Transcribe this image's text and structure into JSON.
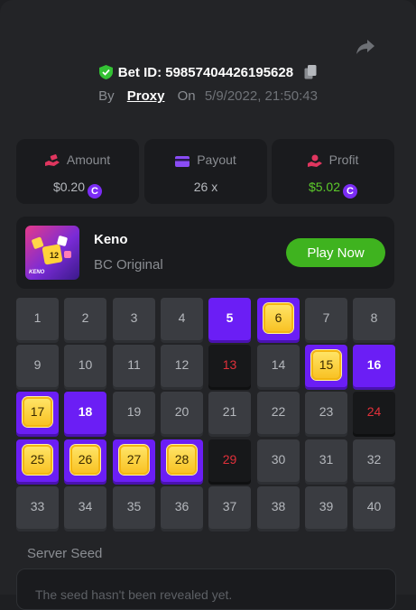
{
  "bet": {
    "label": "Bet ID:",
    "id": "59857404426195628"
  },
  "byline": {
    "by": "By",
    "user": "Proxy",
    "on": "On",
    "date": "5/9/2022, 21:50:43"
  },
  "stats": [
    {
      "label": "Amount",
      "value": "$0.20",
      "icon": "money-hand-icon",
      "coin": true
    },
    {
      "label": "Payout",
      "value": "26 x",
      "icon": "card-icon",
      "coin": false
    },
    {
      "label": "Profit",
      "value": "$5.02",
      "icon": "coin-hand-icon",
      "coin": true,
      "color": "#5dcb2b"
    }
  ],
  "game": {
    "name": "Keno",
    "subtitle": "BC Original",
    "play": "Play Now",
    "thumb_label": "KENO",
    "thumb_number": "12"
  },
  "grid": [
    {
      "n": "1",
      "s": "none"
    },
    {
      "n": "2",
      "s": "none"
    },
    {
      "n": "3",
      "s": "none"
    },
    {
      "n": "4",
      "s": "none"
    },
    {
      "n": "5",
      "s": "selected"
    },
    {
      "n": "6",
      "s": "hit"
    },
    {
      "n": "7",
      "s": "none"
    },
    {
      "n": "8",
      "s": "none"
    },
    {
      "n": "9",
      "s": "none"
    },
    {
      "n": "10",
      "s": "none"
    },
    {
      "n": "11",
      "s": "none"
    },
    {
      "n": "12",
      "s": "none"
    },
    {
      "n": "13",
      "s": "miss"
    },
    {
      "n": "14",
      "s": "none"
    },
    {
      "n": "15",
      "s": "hit"
    },
    {
      "n": "16",
      "s": "selected"
    },
    {
      "n": "17",
      "s": "hit"
    },
    {
      "n": "18",
      "s": "selected"
    },
    {
      "n": "19",
      "s": "none"
    },
    {
      "n": "20",
      "s": "none"
    },
    {
      "n": "21",
      "s": "none"
    },
    {
      "n": "22",
      "s": "none"
    },
    {
      "n": "23",
      "s": "none"
    },
    {
      "n": "24",
      "s": "miss"
    },
    {
      "n": "25",
      "s": "hit"
    },
    {
      "n": "26",
      "s": "hit"
    },
    {
      "n": "27",
      "s": "hit"
    },
    {
      "n": "28",
      "s": "hit"
    },
    {
      "n": "29",
      "s": "miss"
    },
    {
      "n": "30",
      "s": "none"
    },
    {
      "n": "31",
      "s": "none"
    },
    {
      "n": "32",
      "s": "none"
    },
    {
      "n": "33",
      "s": "none"
    },
    {
      "n": "34",
      "s": "none"
    },
    {
      "n": "35",
      "s": "none"
    },
    {
      "n": "36",
      "s": "none"
    },
    {
      "n": "37",
      "s": "none"
    },
    {
      "n": "38",
      "s": "none"
    },
    {
      "n": "39",
      "s": "none"
    },
    {
      "n": "40",
      "s": "none"
    }
  ],
  "seed": {
    "label": "Server Seed",
    "text": "The seed hasn't been revealed yet."
  },
  "colors": {
    "accent": "#6b1ef5",
    "green": "#3fb31f",
    "miss": "#e0303a",
    "gold": "#f8c020"
  }
}
